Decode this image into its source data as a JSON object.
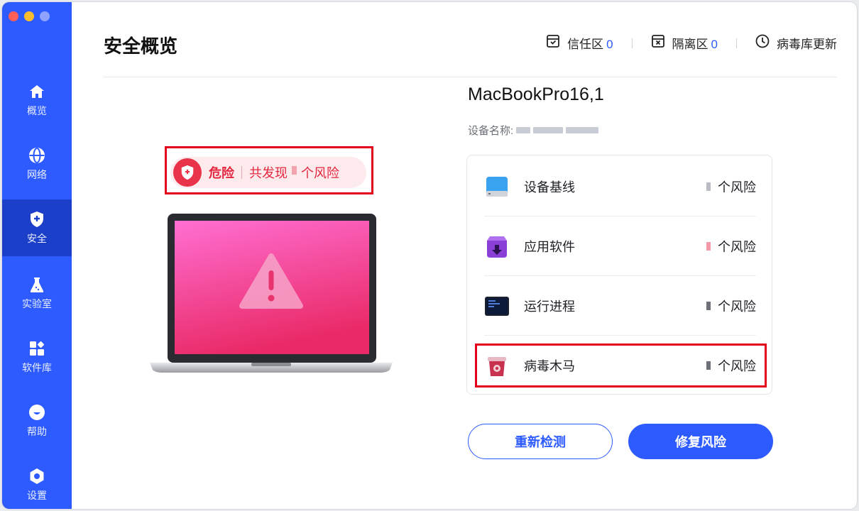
{
  "colors": {
    "brand": "#2d5bff",
    "danger": "#e2263f",
    "highlight": "#e2001a"
  },
  "sidebar": {
    "items": [
      {
        "label": "概览",
        "icon": "home-icon"
      },
      {
        "label": "网络",
        "icon": "globe-icon"
      },
      {
        "label": "安全",
        "icon": "shield-plus-icon",
        "active": true
      },
      {
        "label": "实验室",
        "icon": "flask-icon"
      },
      {
        "label": "软件库",
        "icon": "apps-icon"
      },
      {
        "label": "帮助",
        "icon": "help-icon"
      },
      {
        "label": "设置",
        "icon": "settings-icon"
      }
    ]
  },
  "header": {
    "title": "安全概览",
    "trust_zone": {
      "label": "信任区",
      "count": "0"
    },
    "quarantine": {
      "label": "隔离区",
      "count": "0"
    },
    "virus_db_update": "病毒库更新"
  },
  "status": {
    "level": "危险",
    "found_prefix": "共发现",
    "found_suffix": "个风险"
  },
  "device": {
    "model": "MacBookPro16,1",
    "name_label": "设备名称:"
  },
  "risk_items": [
    {
      "label": "设备基线",
      "count_suffix": "个风险",
      "icon": "disk-icon"
    },
    {
      "label": "应用软件",
      "count_suffix": "个风险",
      "icon": "app-download-icon"
    },
    {
      "label": "运行进程",
      "count_suffix": "个风险",
      "icon": "terminal-icon"
    },
    {
      "label": "病毒木马",
      "count_suffix": "个风险",
      "icon": "virus-bin-icon"
    }
  ],
  "actions": {
    "rescan": "重新检测",
    "fix": "修复风险"
  }
}
